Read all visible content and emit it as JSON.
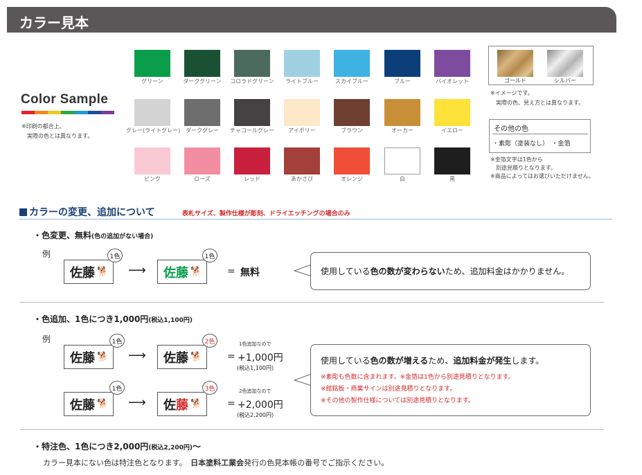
{
  "header": {
    "title": "カラー見本"
  },
  "left": {
    "color_sample_title": "Color Sample",
    "rainbow_colors": [
      "#e8212b",
      "#f08a1d",
      "#f3c71a",
      "#35a544",
      "#1c9bd7",
      "#1d4f9a",
      "#7d3c8f"
    ],
    "note_line1": "※印刷の都合上、",
    "note_line2": "実際の色とは異なります。"
  },
  "swatches": [
    {
      "label": "グリーン",
      "color": "#0a9e4b"
    },
    {
      "label": "ダークグリーン",
      "color": "#1a5134"
    },
    {
      "label": "コロラドグリーン",
      "color": "#4c6b5f"
    },
    {
      "label": "ライトブルー",
      "color": "#9fd1e3"
    },
    {
      "label": "スカイブルー",
      "color": "#3eb3e3"
    },
    {
      "label": "ブルー",
      "color": "#0c3e7a"
    },
    {
      "label": "バイオレット",
      "color": "#7e4c9f"
    },
    {
      "label": "グレー(ライトグレー)",
      "color": "#d3d3d3"
    },
    {
      "label": "ダークグレー",
      "color": "#6e6e6e"
    },
    {
      "label": "チャコールグレー",
      "color": "#454244"
    },
    {
      "label": "アイボリー",
      "color": "#fde9c8"
    },
    {
      "label": "ブラウン",
      "color": "#6f3f32"
    },
    {
      "label": "オーカー",
      "color": "#c98f37"
    },
    {
      "label": "イエロー",
      "color": "#fee139"
    },
    {
      "label": "ピンク",
      "color": "#f9c9d4"
    },
    {
      "label": "ローズ",
      "color": "#f38ea2"
    },
    {
      "label": "レッド",
      "color": "#c8203d"
    },
    {
      "label": "あかさび",
      "color": "#a3403a"
    },
    {
      "label": "オレンジ",
      "color": "#f04e36"
    },
    {
      "label": "白",
      "color": "#ffffff"
    },
    {
      "label": "黒",
      "color": "#1e1e1e"
    }
  ],
  "metal": {
    "gold_label": "ゴールド",
    "silver_label": "シルバー",
    "note_line1": "※イメージです。",
    "note_line2": "実際の色、見え方とは異なります。"
  },
  "other_colors": {
    "title": "その他の色",
    "items": "・素彫（塗装なし）　・金箔",
    "note_line1": "※金箔文字は1色から",
    "note_line2": "別途見積りとなります。",
    "note_line3": "※商品によってはお選びいただけません。"
  },
  "section": {
    "heading": "カラーの変更、追加について",
    "subheading": "表札サイズ、製作仕様が彫刻、ドライエッチングの場合のみ"
  },
  "change": {
    "title": "・色変更、無料",
    "title_note": "(色の追加がない場合)",
    "example_label": "例",
    "name": "佐藤",
    "dog": "🐕",
    "badge_before": "1色",
    "badge_after": "1色",
    "eq": "=",
    "price": "無料",
    "bubble_pre": "使用している",
    "bubble_bold": "色の数が変わらない",
    "bubble_post": "ため、追加料金はかかりません。"
  },
  "add": {
    "title": "・色追加、1色につき1,000円",
    "title_note": "(税込1,100円)",
    "example_label": "例",
    "row1": {
      "badge_before": "1色",
      "badge_after": "2色",
      "note": "1色追加なので",
      "price": "+1,000円",
      "tax": "(税込1,100円)"
    },
    "row2": {
      "badge_before": "1色",
      "badge_after": "3色",
      "note": "2色追加なので",
      "price": "+2,000円",
      "tax": "(税込2,200円)"
    },
    "name_first": "佐",
    "name_second": "藤",
    "eq": "=",
    "bubble_pre": "使用している",
    "bubble_bold1": "色の数が増える",
    "bubble_mid": "ため、",
    "bubble_bold2": "追加料金が発生",
    "bubble_post": "します。",
    "red_notes": [
      "※素彫も色数に含まれます。※金箔は1色から別途見積りとなります。",
      "※館銘板・商業サインは別途見積りとなります。",
      "※その他の製作仕様については別途見積りとなります。"
    ]
  },
  "special": {
    "title": "・特注色、1色につき2,000円",
    "title_note": "(税込2,200円)",
    "title_tail": "〜",
    "desc_pre": "カラー見本にない色は特注色となります。",
    "desc_bold": "日本塗料工業会",
    "desc_post": "発行の色見本帳の番号でご指示ください。"
  }
}
